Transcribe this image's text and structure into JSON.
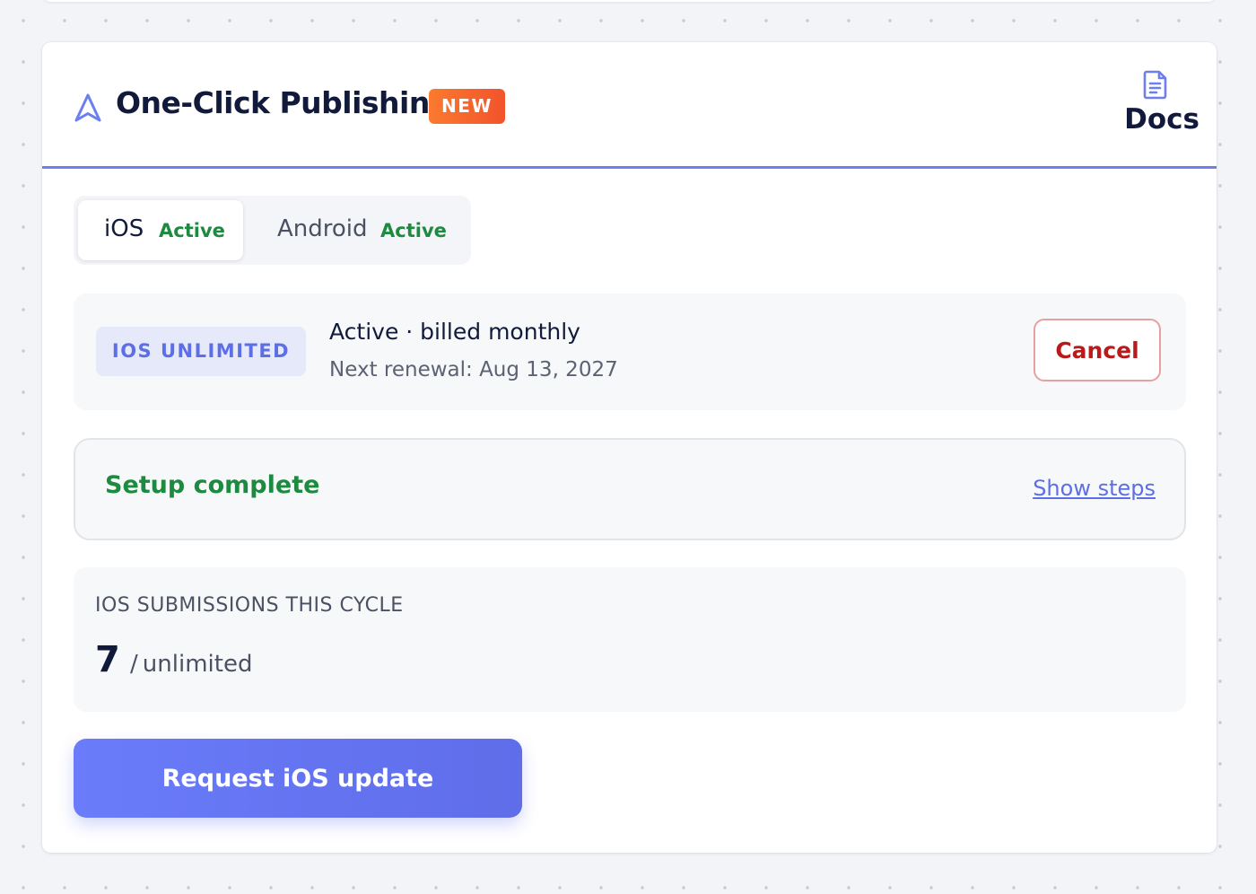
{
  "header": {
    "title": "One-Click Publishing",
    "badge": "NEW",
    "docs_label": "Docs",
    "icons": {
      "title_icon": "navigation-arrow-icon",
      "docs_icon": "document-icon"
    }
  },
  "tabs": [
    {
      "label": "iOS",
      "status": "Active",
      "selected": true
    },
    {
      "label": "Android",
      "status": "Active",
      "selected": false
    }
  ],
  "plan": {
    "badge": "IOS UNLIMITED",
    "status_line": "Active · billed monthly",
    "renewal": "Next renewal: Aug 13, 2027",
    "cancel_label": "Cancel"
  },
  "setup": {
    "title": "Setup complete",
    "toggle_label": "Show steps"
  },
  "usage": {
    "label": "IOS SUBMISSIONS THIS CYCLE",
    "count": "7",
    "separator": "/",
    "limit": "unlimited"
  },
  "actions": {
    "request_label": "Request iOS update"
  },
  "colors": {
    "accent": "#6b7ff0",
    "active_green": "#1c8a3f",
    "cancel_red": "#b81b1b",
    "badge_orange": "#f2532b",
    "title_text": "#111a3a"
  }
}
